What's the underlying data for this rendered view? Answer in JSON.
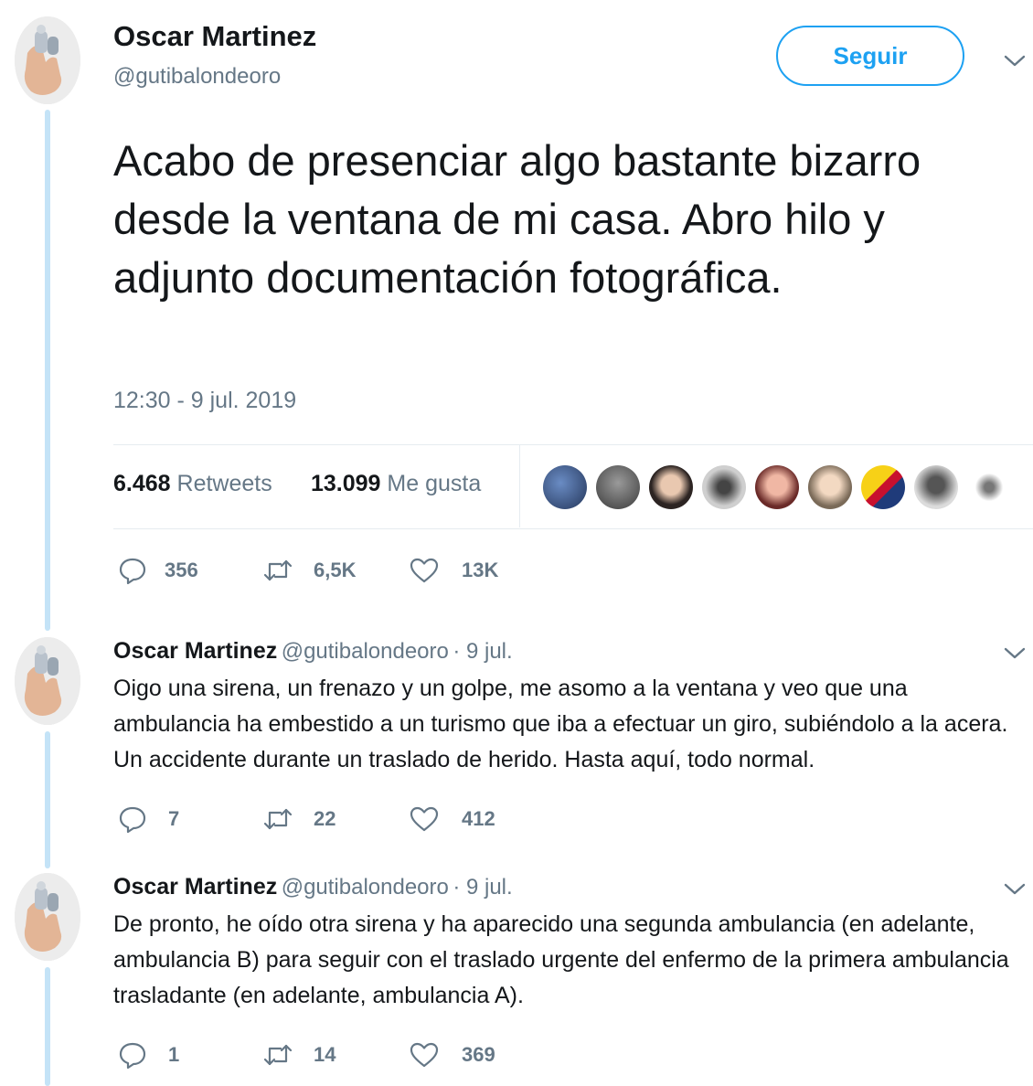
{
  "author": {
    "name": "Oscar Martinez",
    "handle": "@gutibalondeoro"
  },
  "follow_label": "Seguir",
  "main_tweet": {
    "text": "Acabo de presenciar algo bastante bizarro desde la ventana de mi casa. Abro hilo y adjunto documentación fotográfica.",
    "timestamp": "12:30 - 9 jul. 2019",
    "retweets_count": "6.468",
    "retweets_label": "Retweets",
    "likes_count": "13.099",
    "likes_label": "Me gusta",
    "actions": {
      "replies": "356",
      "retweets": "6,5K",
      "likes": "13K"
    }
  },
  "replies": [
    {
      "name": "Oscar Martinez",
      "handle": "@gutibalondeoro",
      "date": "· 9 jul.",
      "text": "Oigo una sirena, un frenazo y un golpe, me asomo a la ventana y veo que una ambulancia ha embestido a un turismo que iba a efectuar un giro, subiéndolo a la acera. Un accidente durante un traslado de herido. Hasta aquí, todo normal.",
      "actions": {
        "replies": "7",
        "retweets": "22",
        "likes": "412"
      }
    },
    {
      "name": "Oscar Martinez",
      "handle": "@gutibalondeoro",
      "date": "· 9 jul.",
      "text": "De pronto, he oído otra sirena y ha aparecido una segunda ambulancia (en adelante, ambulancia B) para seguir con el traslado urgente del enfermo de la primera ambulancia trasladante (en adelante, ambulancia A).",
      "actions": {
        "replies": "1",
        "retweets": "14",
        "likes": "369"
      }
    }
  ],
  "icons": {
    "reply": "reply-icon",
    "retweet": "retweet-icon",
    "like": "heart-icon",
    "more": "chevron-down-icon"
  },
  "colors": {
    "accent": "#1da1f2",
    "text": "#14171a",
    "secondary": "#657786",
    "thread_line": "#c4e3f7"
  }
}
